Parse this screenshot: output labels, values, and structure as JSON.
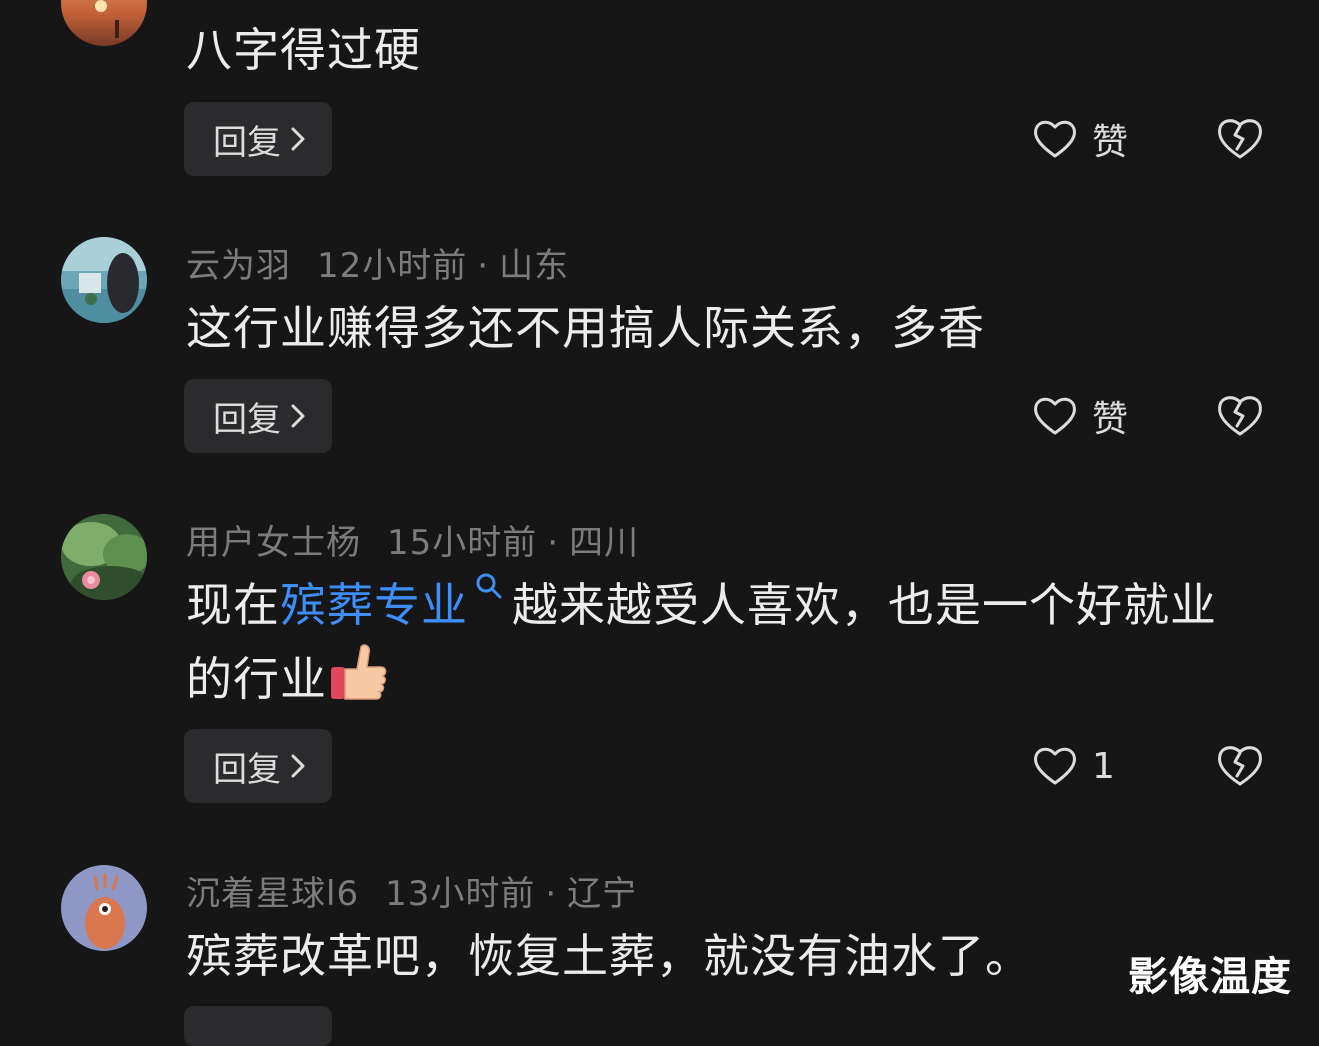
{
  "comments": [
    {
      "user": "",
      "time": "",
      "location": "",
      "text": "八字得过硬",
      "reply_label": "回复",
      "like_label": "赞"
    },
    {
      "user": "云为羽",
      "time": "12小时前",
      "location": "山东",
      "text": "这行业赚得多还不用搞人际关系，多香",
      "reply_label": "回复",
      "like_label": "赞"
    },
    {
      "user": "用户女士杨",
      "time": "15小时前",
      "location": "四川",
      "text_before": "现在",
      "text_link": "殡葬专业",
      "text_after_line1": "越来越受人喜欢，也是一个好就业",
      "text_after_line2": "的行业",
      "emoji": "thumbs-up",
      "reply_label": "回复",
      "like_count": "1"
    },
    {
      "user": "沉着星球l6",
      "time": "13小时前",
      "location": "辽宁",
      "text": "殡葬改革吧，恢复土葬，就没有油水了。"
    }
  ],
  "separator": "·",
  "watermark": "影像温度",
  "colors": {
    "background": "#161617",
    "text": "#ececec",
    "meta": "#7c7c7f",
    "link": "#3e8ef7",
    "button_bg": "#2b2b2d"
  },
  "icons": [
    "heart-icon",
    "broken-heart-icon",
    "chevron-right-icon",
    "search-icon",
    "thumbs-up-emoji"
  ]
}
